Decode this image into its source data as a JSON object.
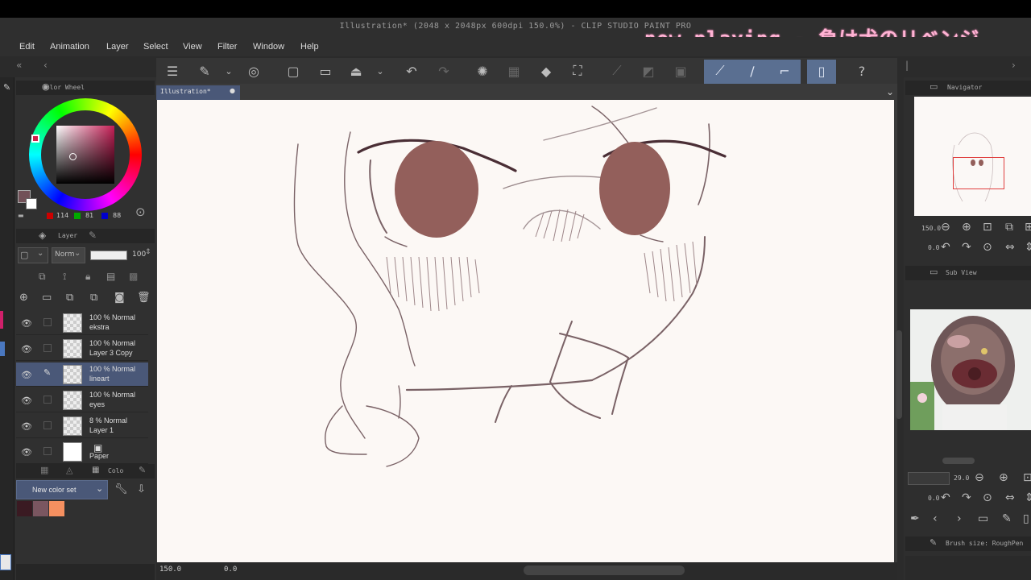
{
  "window": {
    "title": "Illustration* (2048 x 2048px 600dpi 150.0%)  - CLIP STUDIO PAINT PRO",
    "overlay": "now playing - 負け犬のリベンジ"
  },
  "menu": [
    "Edit",
    "Animation",
    "Layer",
    "Select",
    "View",
    "Filter",
    "Window",
    "Help"
  ],
  "toolbar": {
    "icons": [
      "menu-icon",
      "hand-icon",
      "chevron-down-icon",
      "spiral-icon",
      "new-file-icon",
      "open-file-icon",
      "export-icon",
      "chevron-down-icon",
      "undo-icon",
      "redo-icon",
      "loading-icon",
      "select-icon",
      "fill-icon",
      "transform-icon",
      "snap-ruler-icon",
      "snap-grid-icon",
      "snap-icon",
      "pen-stabilize-icon",
      "brush-icon",
      "pencil-icon",
      "tablet-icon",
      "help-icon"
    ]
  },
  "color_wheel": {
    "title": "Color Wheel",
    "r": "114",
    "g": "81",
    "b": "88",
    "current_color": "#725158"
  },
  "layer_panel": {
    "title": "Layer",
    "blend": "Norm",
    "opacity": "100",
    "layers": [
      {
        "line1": "100 % Normal",
        "line2": "ekstra",
        "selected": false
      },
      {
        "line1": "100 % Normal",
        "line2": "Layer 3 Copy",
        "selected": false
      },
      {
        "line1": "100 % Normal",
        "line2": "lineart",
        "selected": true
      },
      {
        "line1": "100 % Normal",
        "line2": "eyes",
        "selected": false
      },
      {
        "line1": "8 % Normal",
        "line2": "Layer 1",
        "selected": false
      },
      {
        "line1": "",
        "line2": "Paper",
        "selected": false
      }
    ]
  },
  "color_set": {
    "tab": "Colo",
    "dropdown": "New color set",
    "swatches": [
      "#3a1a22",
      "#7a5660",
      "#f59060"
    ]
  },
  "document": {
    "tab": "Illustration*",
    "zoom": "150.0",
    "rotation": "0.0"
  },
  "navigator": {
    "title": "Navigator",
    "zoom": "150.0",
    "angle": "0.0"
  },
  "subview": {
    "title": "Sub View",
    "zoom": "29.0",
    "angle": "0.0"
  },
  "brush_size": {
    "title": "Brush size: RoughPen"
  }
}
